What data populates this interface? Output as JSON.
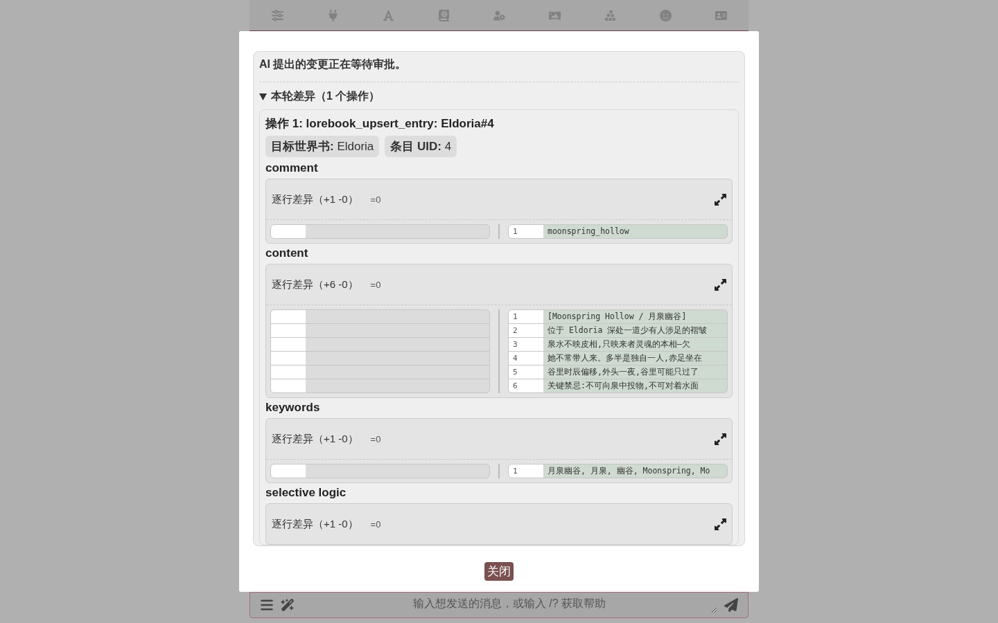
{
  "notice": "AI 提出的变更正在等待审批。",
  "diff_section": {
    "title": "本轮差异（1 个操作）",
    "expanded": true
  },
  "operation": {
    "title": "操作 1: lorebook_upsert_entry: Eldoria#4",
    "tags": [
      {
        "label": "目标世界书:",
        "value": "Eldoria"
      },
      {
        "label": "条目 UID:",
        "value": "4"
      }
    ],
    "fields": [
      {
        "name": "comment",
        "summary": "逐行差异（+1 -0）",
        "equals": "=0",
        "lines": [
          {
            "number": "1",
            "text": "moonspring_hollow"
          }
        ]
      },
      {
        "name": "content",
        "summary": "逐行差异（+6 -0）",
        "equals": "=0",
        "lines": [
          {
            "number": "1",
            "text": "[Moonspring Hollow / 月泉幽谷]"
          },
          {
            "number": "2",
            "text": "位于 Eldoria 深处一道少有人涉足的褶皱"
          },
          {
            "number": "3",
            "text": "泉水不映皮相,只映来者灵魂的本相—欠"
          },
          {
            "number": "4",
            "text": "她不常带人来。多半是独自一人,赤足坐在"
          },
          {
            "number": "5",
            "text": "谷里时辰偏移,外头一夜,谷里可能只过了"
          },
          {
            "number": "6",
            "text": "关键禁忌:不可向泉中投物,不可对着水面"
          }
        ]
      },
      {
        "name": "keywords",
        "summary": "逐行差异（+1 -0）",
        "equals": "=0",
        "lines": [
          {
            "number": "1",
            "text": "月泉幽谷, 月泉, 幽谷, Moonspring, Mo"
          }
        ]
      },
      {
        "name": "selective logic",
        "summary": "逐行差异（+1 -0）",
        "equals": "=0"
      }
    ]
  },
  "close_button": "关闭",
  "chat_input": {
    "placeholder": "输入想发送的消息，或输入 /? 获取帮助"
  }
}
